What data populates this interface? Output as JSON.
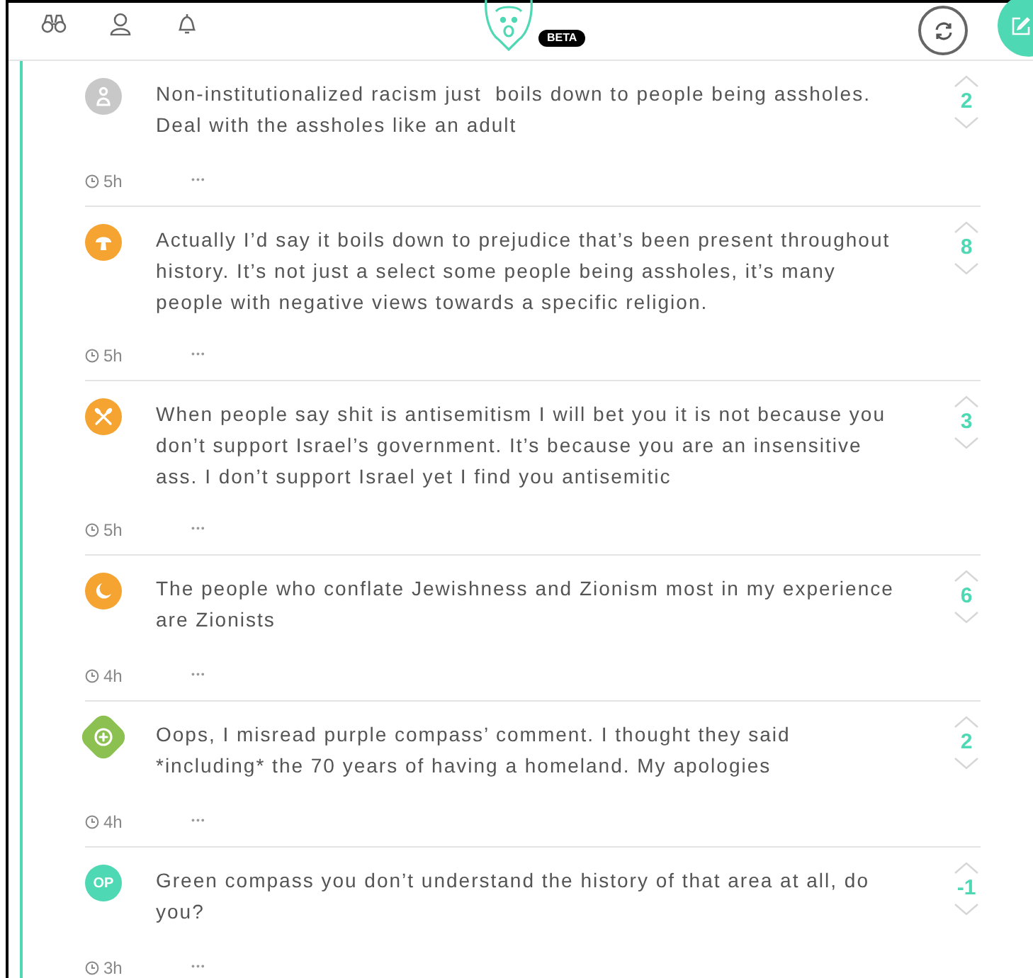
{
  "header": {
    "badge": "BETA"
  },
  "comments": [
    {
      "avatar": {
        "kind": "figure",
        "color": "#c8c8c8"
      },
      "text": "Non-institutionalized racism just  boils down to people being assholes. Deal with the assholes like an adult",
      "votes": "2",
      "time": "5h",
      "more": "•••"
    },
    {
      "avatar": {
        "kind": "mushroom",
        "color": "#f5a431"
      },
      "text": "Actually I’d say it boils down to prejudice that’s been present throughout history. It’s not just a select some people being assholes, it’s many people with negative views towards a specific religion.",
      "votes": "8",
      "time": "5h",
      "more": "•••"
    },
    {
      "avatar": {
        "kind": "paddles",
        "color": "#f5a431"
      },
      "text": "When people say shit is antisemitism I will bet you it is not because you don’t support Israel’s government. It’s because you are an insensitive ass. I don’t support Israel yet I find you antisemitic",
      "votes": "3",
      "time": "5h",
      "more": "•••"
    },
    {
      "avatar": {
        "kind": "crescent",
        "color": "#f5a431"
      },
      "text": "The people who conflate Jewishness and Zionism most in my experience are Zionists",
      "votes": "6",
      "time": "4h",
      "more": "•••"
    },
    {
      "avatar": {
        "kind": "target",
        "color": "#8cc152"
      },
      "text": "Oops, I misread purple compass’ comment. I thought they said *including* the 70 years of having a homeland. My apologies",
      "votes": "2",
      "time": "4h",
      "more": "•••"
    },
    {
      "avatar": {
        "kind": "text",
        "label": "OP",
        "color": "#4fd8b4"
      },
      "text": "Green compass you don’t understand the history of that area at all, do you?",
      "votes": "-1",
      "time": "3h",
      "more": "•••"
    }
  ]
}
